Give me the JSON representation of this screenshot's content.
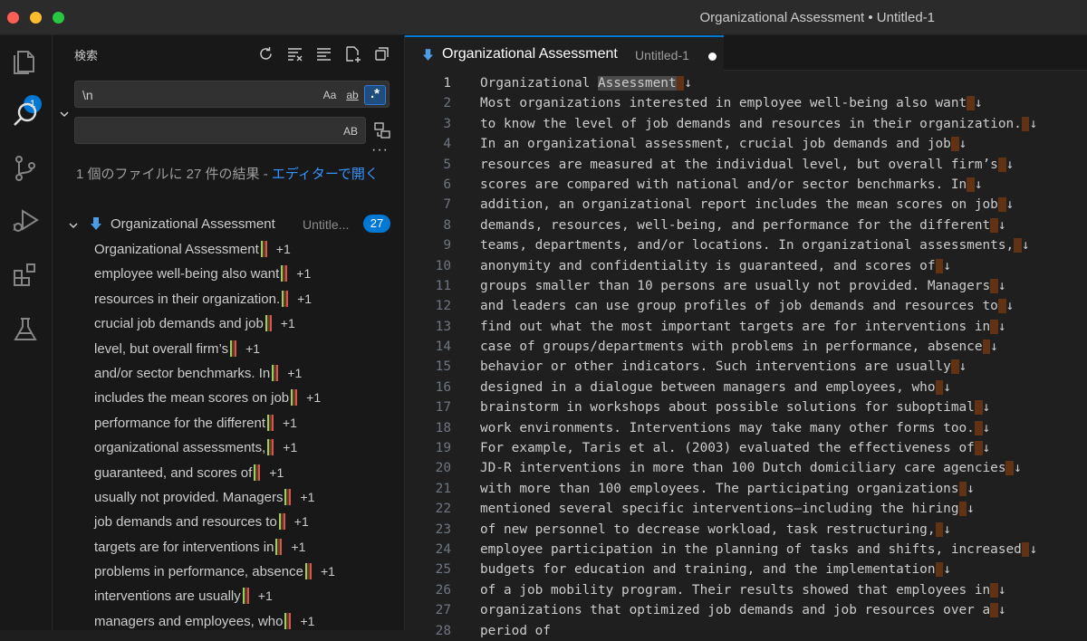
{
  "window": {
    "title": "Organizational Assessment • Untitled-1"
  },
  "activity": {
    "explorer_badge": "1"
  },
  "search": {
    "title": "検索",
    "query": "\\n",
    "replace_value": "",
    "opt_case": "Aa",
    "opt_word": "ab",
    "opt_regex": ".*",
    "opt_preserve_case": "AB",
    "more": "···",
    "summary_prefix": "1 個のファイルに 27 件の結果 - ",
    "summary_link": "エディターで開く",
    "file_name": "Organizational Assessment",
    "file_desc": "Untitle...",
    "file_count": "27",
    "results": [
      {
        "text": "Organizational Assessment",
        "inc": "+1"
      },
      {
        "text": "employee well-being also want",
        "inc": "+1"
      },
      {
        "text": "resources in their organization.",
        "inc": "+1"
      },
      {
        "text": "crucial job demands and job",
        "inc": "+1"
      },
      {
        "text": "level, but overall firm’s",
        "inc": "+1"
      },
      {
        "text": "and/or sector benchmarks. In",
        "inc": "+1"
      },
      {
        "text": "includes the mean scores on job",
        "inc": "+1"
      },
      {
        "text": "performance for the different",
        "inc": "+1"
      },
      {
        "text": "organizational assessments,",
        "inc": "+1"
      },
      {
        "text": "guaranteed, and scores of",
        "inc": "+1"
      },
      {
        "text": "usually not provided. Managers",
        "inc": "+1"
      },
      {
        "text": "job demands and resources to",
        "inc": "+1"
      },
      {
        "text": "targets are for interventions in",
        "inc": "+1"
      },
      {
        "text": "problems in performance, absence",
        "inc": "+1"
      },
      {
        "text": "interventions are usually",
        "inc": "+1"
      },
      {
        "text": "managers and employees, who",
        "inc": "+1"
      }
    ]
  },
  "editor": {
    "tab_name": "Organizational Assessment",
    "tab_desc": "Untitled-1",
    "newline_glyph": "↓",
    "lines": [
      {
        "n": "1",
        "pre": "Organizational ",
        "hl": "Assessment",
        "post": ""
      },
      {
        "n": "2",
        "pre": "Most organizations interested in employee well-being also want",
        "hl": "",
        "post": ""
      },
      {
        "n": "3",
        "pre": "to know the level of job demands and resources in their organization.",
        "hl": "",
        "post": ""
      },
      {
        "n": "4",
        "pre": "In an organizational assessment, crucial job demands and job",
        "hl": "",
        "post": ""
      },
      {
        "n": "5",
        "pre": "resources are measured at the individual level, but overall firm’s",
        "hl": "",
        "post": ""
      },
      {
        "n": "6",
        "pre": "scores are compared with national and/or sector benchmarks. In",
        "hl": "",
        "post": ""
      },
      {
        "n": "7",
        "pre": "addition, an organizational report includes the mean scores on job",
        "hl": "",
        "post": ""
      },
      {
        "n": "8",
        "pre": "demands, resources, well-being, and performance for the different",
        "hl": "",
        "post": ""
      },
      {
        "n": "9",
        "pre": "teams, departments, and/or locations. In organizational assessments,",
        "hl": "",
        "post": ""
      },
      {
        "n": "10",
        "pre": "anonymity and confidentiality is guaranteed, and scores of",
        "hl": "",
        "post": ""
      },
      {
        "n": "11",
        "pre": "groups smaller than 10 persons are usually not provided. Managers",
        "hl": "",
        "post": ""
      },
      {
        "n": "12",
        "pre": "and leaders can use group profiles of job demands and resources to",
        "hl": "",
        "post": ""
      },
      {
        "n": "13",
        "pre": "find out what the most important targets are for interventions in",
        "hl": "",
        "post": ""
      },
      {
        "n": "14",
        "pre": "case of groups/departments with problems in performance, absence",
        "hl": "",
        "post": ""
      },
      {
        "n": "15",
        "pre": "behavior or other indicators. Such interventions are usually",
        "hl": "",
        "post": ""
      },
      {
        "n": "16",
        "pre": "designed in a dialogue between managers and employees, who",
        "hl": "",
        "post": ""
      },
      {
        "n": "17",
        "pre": "brainstorm in workshops about possible solutions for suboptimal",
        "hl": "",
        "post": ""
      },
      {
        "n": "18",
        "pre": "work environments. Interventions may take many other forms too.",
        "hl": "",
        "post": ""
      },
      {
        "n": "19",
        "pre": "For example, Taris et al. (2003) evaluated the effectiveness of",
        "hl": "",
        "post": ""
      },
      {
        "n": "20",
        "pre": "JD-R interventions in more than 100 Dutch domiciliary care agencies",
        "hl": "",
        "post": ""
      },
      {
        "n": "21",
        "pre": "with more than 100 employees. The participating organizations",
        "hl": "",
        "post": ""
      },
      {
        "n": "22",
        "pre": "mentioned several specific interventions—including the hiring",
        "hl": "",
        "post": ""
      },
      {
        "n": "23",
        "pre": "of new personnel to decrease workload, task restructuring,",
        "hl": "",
        "post": ""
      },
      {
        "n": "24",
        "pre": "employee participation in the planning of tasks and shifts, increased",
        "hl": "",
        "post": ""
      },
      {
        "n": "25",
        "pre": "budgets for education and training, and the implementation",
        "hl": "",
        "post": ""
      },
      {
        "n": "26",
        "pre": "of a job mobility program. Their results showed that employees in",
        "hl": "",
        "post": ""
      },
      {
        "n": "27",
        "pre": "organizations that optimized job demands and job resources over a",
        "hl": "",
        "post": ""
      },
      {
        "n": "28",
        "pre": "period of",
        "hl": "",
        "post": ""
      }
    ]
  }
}
